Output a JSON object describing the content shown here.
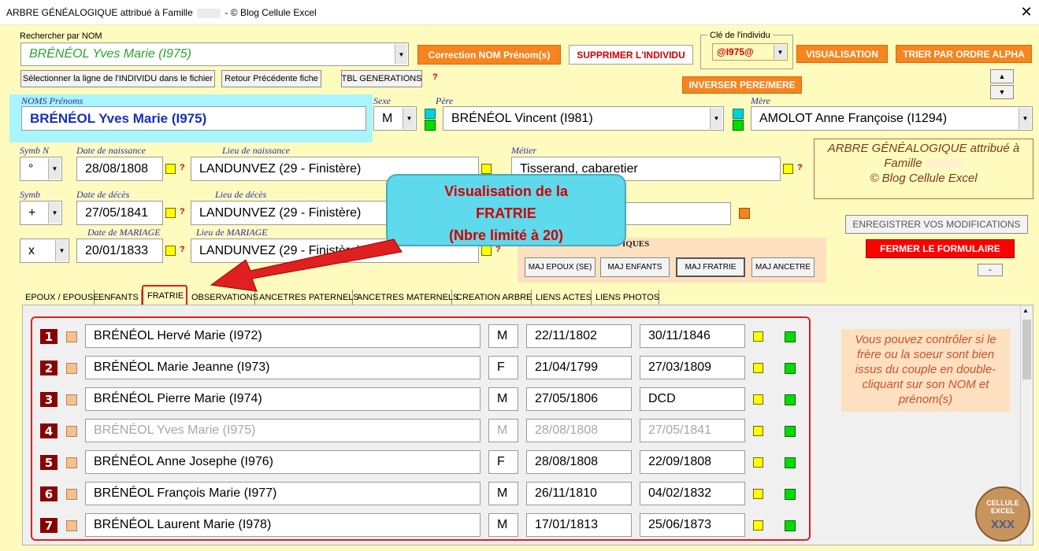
{
  "window": {
    "title_prefix": "ARBRE GÉNÉALOGIQUE attribué à Famille",
    "title_suffix": "- © Blog Cellule Excel",
    "close_glyph": "✕"
  },
  "search": {
    "label": "Rechercher par NOM",
    "value": "BRÉNÉOL Yves Marie (I975)"
  },
  "buttons": {
    "correction": "Correction NOM Prénom(s)",
    "supprimer": "SUPPRIMER L'INDIVIDU",
    "visualisation": "VISUALISATION",
    "trier": "TRIER PAR ORDRE ALPHA",
    "select_ligne": "Sélectionner la ligne de l'INDIVIDU  dans le fichier",
    "retour": "Retour Précédente fiche",
    "tbl_generations": "TBL GENERATIONS",
    "inverser": "INVERSER PERE/MERE",
    "enregistrer": "ENREGISTRER VOS MODIFICATIONS",
    "fermer": "FERMER LE FORMULAIRE",
    "maj_epoux": "MAJ EPOUX (SE)",
    "maj_enfants": "MAJ ENFANTS",
    "maj_fratrie": "MAJ FRATRIE",
    "maj_ancetre": "MAJ ANCETRE",
    "minus": "-",
    "up": "▲",
    "down": "▼"
  },
  "cle": {
    "label": "Clé de l'individu",
    "value": "@I975@"
  },
  "help_mark": "?",
  "individu": {
    "noms_label": "NOMS Prénoms",
    "noms_value": "BRÉNÉOL Yves Marie (I975)",
    "sexe_label": "Sexe",
    "sexe_value": "M",
    "pere_label": "Père",
    "pere_value": "BRÉNÉOL Vincent (I981)",
    "mere_label": "Mère",
    "mere_value": "AMOLOT Anne Françoise (I1294)",
    "symbn_label": "Symb N",
    "symbn_value": "°",
    "naissance_date_label": "Date de naissance",
    "naissance_date": "28/08/1808",
    "naissance_lieu_label": "Lieu de naissance",
    "naissance_lieu": "LANDUNVEZ (29 - Finistère)",
    "metier_label": "Métier",
    "metier_value": "Tisserand, cabaretier",
    "symb_label": "Symb",
    "symb_value": "+",
    "deces_date_label": "Date de décès",
    "deces_date": "27/05/1841",
    "deces_lieu_label": "Lieu de décès",
    "deces_lieu": "LANDUNVEZ (29 - Finistère)",
    "mariage_symb": "x",
    "mariage_date_label": "Date de MARIAGE",
    "mariage_date": "20/01/1833",
    "mariage_lieu_label": "Lieu de MARIAGE",
    "mariage_lieu": "LANDUNVEZ (29 - Finistère)"
  },
  "brand_box": {
    "line1": "ARBRE GÉNÉALOGIQUE attribué à",
    "line2": "Famille",
    "line3": "© Blog Cellule Excel"
  },
  "stats_label": "IQUES",
  "callout": {
    "line1": "Visualisation de la",
    "line2": "FRATRIE",
    "line3": "(Nbre limité à 20)"
  },
  "tabs": [
    "EPOUX / EPOUSE",
    "ENFANTS",
    "FRATRIE",
    "OBSERVATIONS",
    "ANCETRES PATERNELS",
    "ANCETRES MATERNELS",
    "CREATION ARBRE",
    "LIENS ACTES",
    "LIENS PHOTOS"
  ],
  "active_tab": "FRATRIE",
  "fratrie": [
    {
      "num": "1",
      "name": "BRÉNÉOL Hervé Marie (I972)",
      "sexe": "M",
      "naissance": "22/11/1802",
      "deces": "30/11/1846",
      "dim": false
    },
    {
      "num": "2",
      "name": "BRÉNÉOL Marie Jeanne (I973)",
      "sexe": "F",
      "naissance": "21/04/1799",
      "deces": "27/03/1809",
      "dim": false
    },
    {
      "num": "3",
      "name": "BRÉNÉOL Pierre Marie (I974)",
      "sexe": "M",
      "naissance": "27/05/1806",
      "deces": "DCD",
      "dim": false
    },
    {
      "num": "4",
      "name": "BRÉNÉOL Yves Marie (I975)",
      "sexe": "M",
      "naissance": "28/08/1808",
      "deces": "27/05/1841",
      "dim": true
    },
    {
      "num": "5",
      "name": "BRÉNÉOL Anne Josephe (I976)",
      "sexe": "F",
      "naissance": "28/08/1808",
      "deces": "22/09/1808",
      "dim": false
    },
    {
      "num": "6",
      "name": "BRÉNÉOL François Marie (I977)",
      "sexe": "M",
      "naissance": "26/11/1810",
      "deces": "04/02/1832",
      "dim": false
    },
    {
      "num": "7",
      "name": "BRÉNÉOL Laurent Marie (I978)",
      "sexe": "M",
      "naissance": "17/01/1813",
      "deces": "25/06/1873",
      "dim": false
    }
  ],
  "info_note": "Vous pouvez contrôler si le frère ou la soeur sont  bien issus du couple en double-cliquant sur son NOM et prénom(s)",
  "logo": {
    "text_top": "CELLULE EXCEL",
    "text_bottom": "XXX"
  },
  "colors": {
    "background": "#fffbbe",
    "orange_button": "#f5851f",
    "red_highlight": "#e02020",
    "callout": "#5fd9ec",
    "row_number": "#8b0000"
  }
}
